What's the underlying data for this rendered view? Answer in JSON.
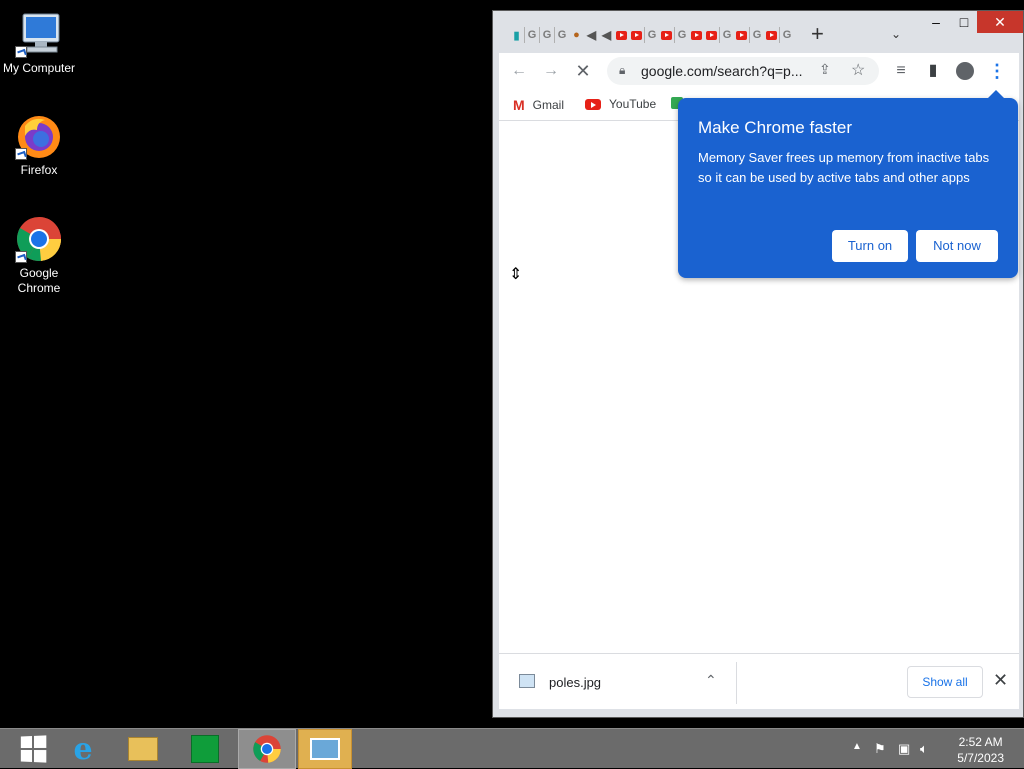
{
  "desktop": {
    "icons": [
      {
        "label": "My Computer"
      },
      {
        "label": "Firefox"
      },
      {
        "label": "Google Chrome"
      }
    ]
  },
  "browser": {
    "url": "google.com/search?q=p...",
    "bookmarks": [
      {
        "label": "Gmail"
      },
      {
        "label": "YouTube"
      }
    ],
    "window_controls": {
      "minimize": "–",
      "maximize": "□",
      "close": "✕"
    }
  },
  "popup": {
    "title": "Make Chrome faster",
    "body": "Memory Saver frees up memory from inactive tabs so it can be used by active tabs and other apps",
    "turn_on": "Turn on",
    "not_now": "Not now"
  },
  "download_shelf": {
    "filename": "poles.jpg",
    "show_all": "Show all"
  },
  "taskbar": {
    "time": "2:52 AM",
    "date": "5/7/2023"
  },
  "colors": {
    "popup_bg": "#1a62d0",
    "close_button": "#c7362b",
    "link_blue": "#1a73e8"
  }
}
